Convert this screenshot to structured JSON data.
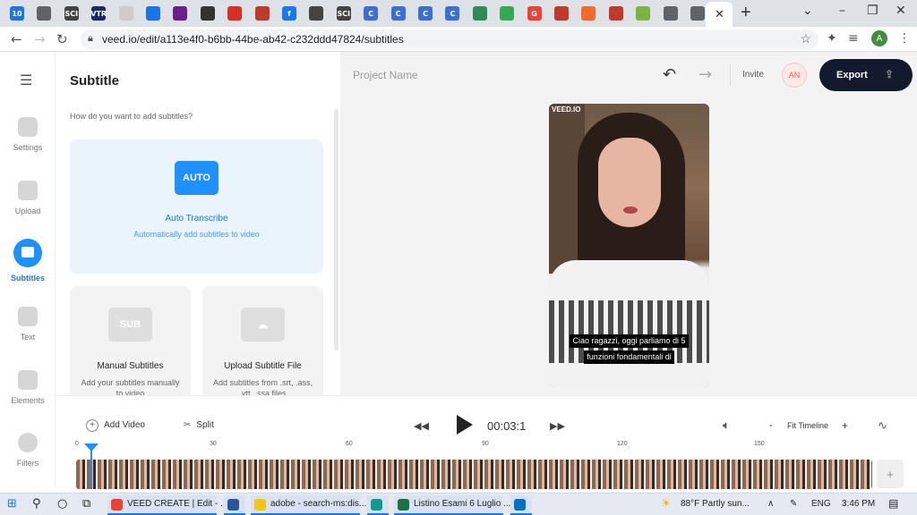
{
  "browser": {
    "tabs": [
      {
        "icon": "calendar-icon",
        "color": "#1a73e8",
        "text": "10"
      },
      {
        "icon": "globe-icon",
        "color": "#5f6368",
        "text": ""
      },
      {
        "icon": "sci-icon",
        "color": "#444444",
        "text": "SCI"
      },
      {
        "icon": "vtr-icon",
        "color": "#1b2a6b",
        "text": "VTR"
      },
      {
        "icon": "cup-icon",
        "color": "#cccccc",
        "text": ""
      },
      {
        "icon": "bookmark-icon",
        "color": "#1a73e8",
        "text": ""
      },
      {
        "icon": "mail-icon",
        "color": "#6b1e8f",
        "text": ""
      },
      {
        "icon": "cap-icon",
        "color": "#333333",
        "text": ""
      },
      {
        "icon": "line-icon",
        "color": "#d93025",
        "text": ""
      },
      {
        "icon": "home-icon",
        "color": "#c0392b",
        "text": ""
      },
      {
        "icon": "facebook-icon",
        "color": "#1877f2",
        "text": "f"
      },
      {
        "icon": "photo-icon",
        "color": "#444444",
        "text": ""
      },
      {
        "icon": "sci-icon",
        "color": "#444444",
        "text": "SCI"
      },
      {
        "icon": "c-icon",
        "color": "#3b6fd6",
        "text": "C"
      },
      {
        "icon": "c-icon",
        "color": "#3b6fd6",
        "text": "C"
      },
      {
        "icon": "c-icon",
        "color": "#3b6fd6",
        "text": "C"
      },
      {
        "icon": "c-icon",
        "color": "#3b6fd6",
        "text": "C"
      },
      {
        "icon": "plant-icon",
        "color": "#2e8b57",
        "text": ""
      },
      {
        "icon": "drive-icon",
        "color": "#34a853",
        "text": ""
      },
      {
        "icon": "google-icon",
        "color": "#ea4335",
        "text": "G"
      },
      {
        "icon": "badge-icon",
        "color": "#c0392b",
        "text": ""
      },
      {
        "icon": "wave-icon",
        "color": "#f26a2b",
        "text": ""
      },
      {
        "icon": "badge-icon",
        "color": "#c0392b",
        "text": ""
      },
      {
        "icon": "leaf-icon",
        "color": "#7cb342",
        "text": ""
      },
      {
        "icon": "wifi-icon",
        "color": "#5f6368",
        "text": ""
      },
      {
        "icon": "globe-icon",
        "color": "#5f6368",
        "text": ""
      }
    ],
    "active_tab_close": "✕",
    "new_tab": "+",
    "url": "veed.io/edit/a113e4f0-b6bb-44be-ab42-c232ddd47824/subtitles",
    "profile_initial": "A",
    "window_controls": [
      "⌄",
      "–",
      "❐",
      "✕"
    ]
  },
  "sidebar": {
    "menu_icon": "☰",
    "items": [
      {
        "label": "Settings",
        "icon": "settings-icon"
      },
      {
        "label": "Upload",
        "icon": "upload-icon"
      },
      {
        "label": "Subtitles",
        "icon": "subtitles-icon"
      },
      {
        "label": "Text",
        "icon": "text-icon"
      },
      {
        "label": "Elements",
        "icon": "elements-icon"
      },
      {
        "label": "Filters",
        "icon": "filters-icon"
      }
    ]
  },
  "panel": {
    "title": "Subtitle",
    "question": "How do you want to add subtitles?",
    "auto": {
      "badge": "AUTO",
      "title": "Auto Transcribe",
      "subtitle": "Automatically add subtitles to video"
    },
    "manual": {
      "badge": "SUB",
      "title": "Manual Subtitles",
      "subtitle": "Add your subtitles manually to video"
    },
    "upload": {
      "badge": "☁",
      "title": "Upload Subtitle File",
      "subtitle": "Add subtitles from .srt, .ass, .vtt, .ssa files"
    }
  },
  "editor": {
    "project_name": "Project Name",
    "invite": "Invite",
    "avatar": "AN",
    "export": "Export",
    "video_logo": "VEED.IO",
    "caption_line1": "Ciao ragazzi, oggi parliamo di 5",
    "caption_line2": "funzioni fondamentali di"
  },
  "timeline": {
    "add_video": "Add Video",
    "split": "Split",
    "time": "00:03:1",
    "fit": "Fit Timeline",
    "ticks": [
      "0",
      "30",
      "60",
      "90",
      "120",
      "150"
    ]
  },
  "taskbar": {
    "apps": [
      {
        "label": "VEED CREATE | Edit - ...",
        "color": "#ea4335"
      },
      {
        "label": "",
        "color": "#2b579a"
      },
      {
        "label": "adobe - search-ms:dis...",
        "color": "#f0c419"
      },
      {
        "label": "",
        "color": "#0f9d8a"
      },
      {
        "label": "Listino Esami 6 Luglio ...",
        "color": "#1e7145"
      },
      {
        "label": "",
        "color": "#0072c6"
      }
    ],
    "weather": "88°F  Partly sun...",
    "lang": "ENG",
    "clock": "3:46 PM"
  }
}
